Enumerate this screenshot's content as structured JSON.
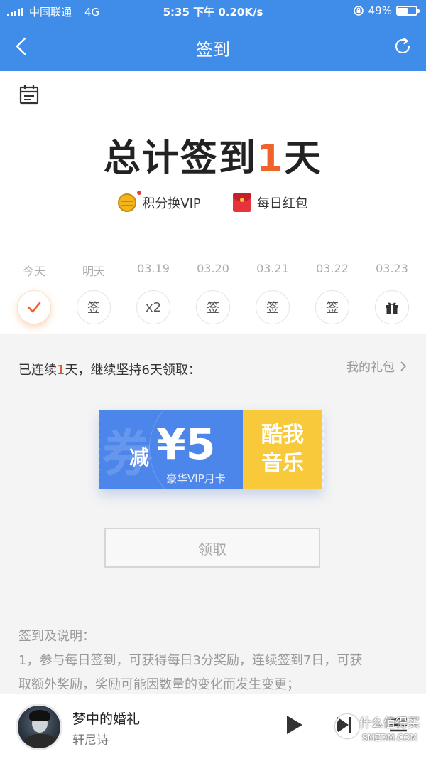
{
  "status_bar": {
    "carrier": "中国联通",
    "network": "4G",
    "time_speed": "5:35 下午 0.20K/s",
    "battery": "49%",
    "battery_level": 0.49
  },
  "nav": {
    "title": "签到"
  },
  "summary": {
    "prefix": "总计签到",
    "count": "1",
    "suffix": "天"
  },
  "links": {
    "exchange": "积分换VIP",
    "red_packet": "每日红包"
  },
  "days": [
    "今天",
    "明天",
    "03.19",
    "03.20",
    "03.21",
    "03.22",
    "03.23"
  ],
  "day_markers": [
    {
      "label": "✓",
      "icon": "check-icon",
      "state": "done"
    },
    {
      "label": "签",
      "state": "pending"
    },
    {
      "label": "x2",
      "state": "pending"
    },
    {
      "label": "签",
      "state": "pending"
    },
    {
      "label": "签",
      "state": "pending"
    },
    {
      "label": "签",
      "state": "pending"
    },
    {
      "label": "",
      "icon": "gift-icon",
      "state": "pending"
    }
  ],
  "streak": {
    "before": "已连续",
    "count": "1",
    "after": "天，继续坚持6天领取："
  },
  "my_gifts": "我的礼包",
  "coupon": {
    "watermark": "券",
    "prefix": "减",
    "amount": "¥5",
    "description": "豪华VIP月卡",
    "brand_line1": "酷我",
    "brand_line2": "音乐",
    "colors": {
      "blue": "#4d86ea",
      "yellow": "#f7c93b"
    }
  },
  "claim_button": "领取",
  "notes": {
    "title": "签到及说明：",
    "line1": "1，参与每日签到，可获得每日3分奖励，连续签到7日，可获",
    "line2": "取额外奖励，奖励可能因数量的变化而发生变更；"
  },
  "player": {
    "song": "梦中的婚礼",
    "artist": "轩尼诗"
  },
  "watermark": {
    "line1": "什么值得买",
    "line2": "SMZDM.COM"
  },
  "colors": {
    "header": "#3f8de8",
    "accent": "#f0622c"
  }
}
